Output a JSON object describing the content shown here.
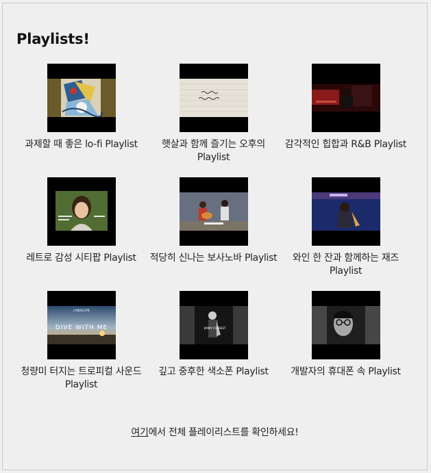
{
  "page": {
    "title": "Playlists!"
  },
  "playlists": [
    {
      "label": "과제할 때 좋은 lo-fi Playlist",
      "thumb": "lofi-collage-art"
    },
    {
      "label": "햇살과 함께 즐기는 오후의 Playlist",
      "thumb": "handwritten-paper"
    },
    {
      "label": "감각적인 힙합과 R&B Playlist",
      "thumb": "car-night-scene"
    },
    {
      "label": "레트로 감성 시티팝 Playlist",
      "thumb": "woman-portrait-green"
    },
    {
      "label": "적당히 신나는 보사노바 Playlist",
      "thumb": "street-musicians"
    },
    {
      "label": "와인 한 잔과 함께하는 재즈 Playlist",
      "thumb": "saxophonist-album-cover"
    },
    {
      "label": "청량미 터지는 트로피컬 사운드 Playlist",
      "thumb": "sunset-sea",
      "overlay_top": "LANDSCAPE",
      "overlay_main": "DIVE WITH ME"
    },
    {
      "label": "깊고 중후한 색소폰 Playlist",
      "thumb": "saxophone-bw-photo",
      "overlay_main": "JIMMY FORREST"
    },
    {
      "label": "개발자의 휴대폰 속 Playlist",
      "thumb": "man-glasses-bw"
    }
  ],
  "footer": {
    "link_text": "여기",
    "rest_text": "에서 전체 플레이리스트를 확인하세요!"
  }
}
